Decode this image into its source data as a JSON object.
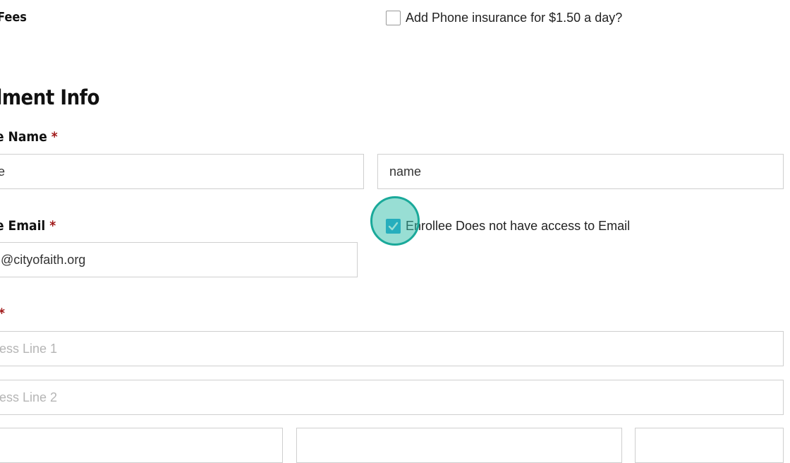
{
  "fees": {
    "label": "Fees",
    "insurance_checkbox_label": "Add Phone insurance for $1.50 a day?",
    "insurance_checked": false
  },
  "enrollment": {
    "heading": "llment Info",
    "name": {
      "label": "e Name",
      "required_mark": "*",
      "first_value": "e",
      "last_value": "name"
    },
    "email": {
      "label": "e Email",
      "required_mark": "*",
      "value": "@cityofaith.org",
      "no_access_label": "Enrollee Does not have access to Email",
      "no_access_checked": true
    },
    "address": {
      "label": "",
      "required_mark": "*",
      "line1_placeholder": "ess Line 1",
      "line2_placeholder": "ess Line 2",
      "city_placeholder": "",
      "state_placeholder": "",
      "zip_placeholder": ""
    }
  },
  "icons": {
    "check": "checkmark-icon"
  },
  "colors": {
    "required": "#a01818",
    "checkbox_checked": "#1a9fd1",
    "click_indicator": "#1aa99a"
  }
}
